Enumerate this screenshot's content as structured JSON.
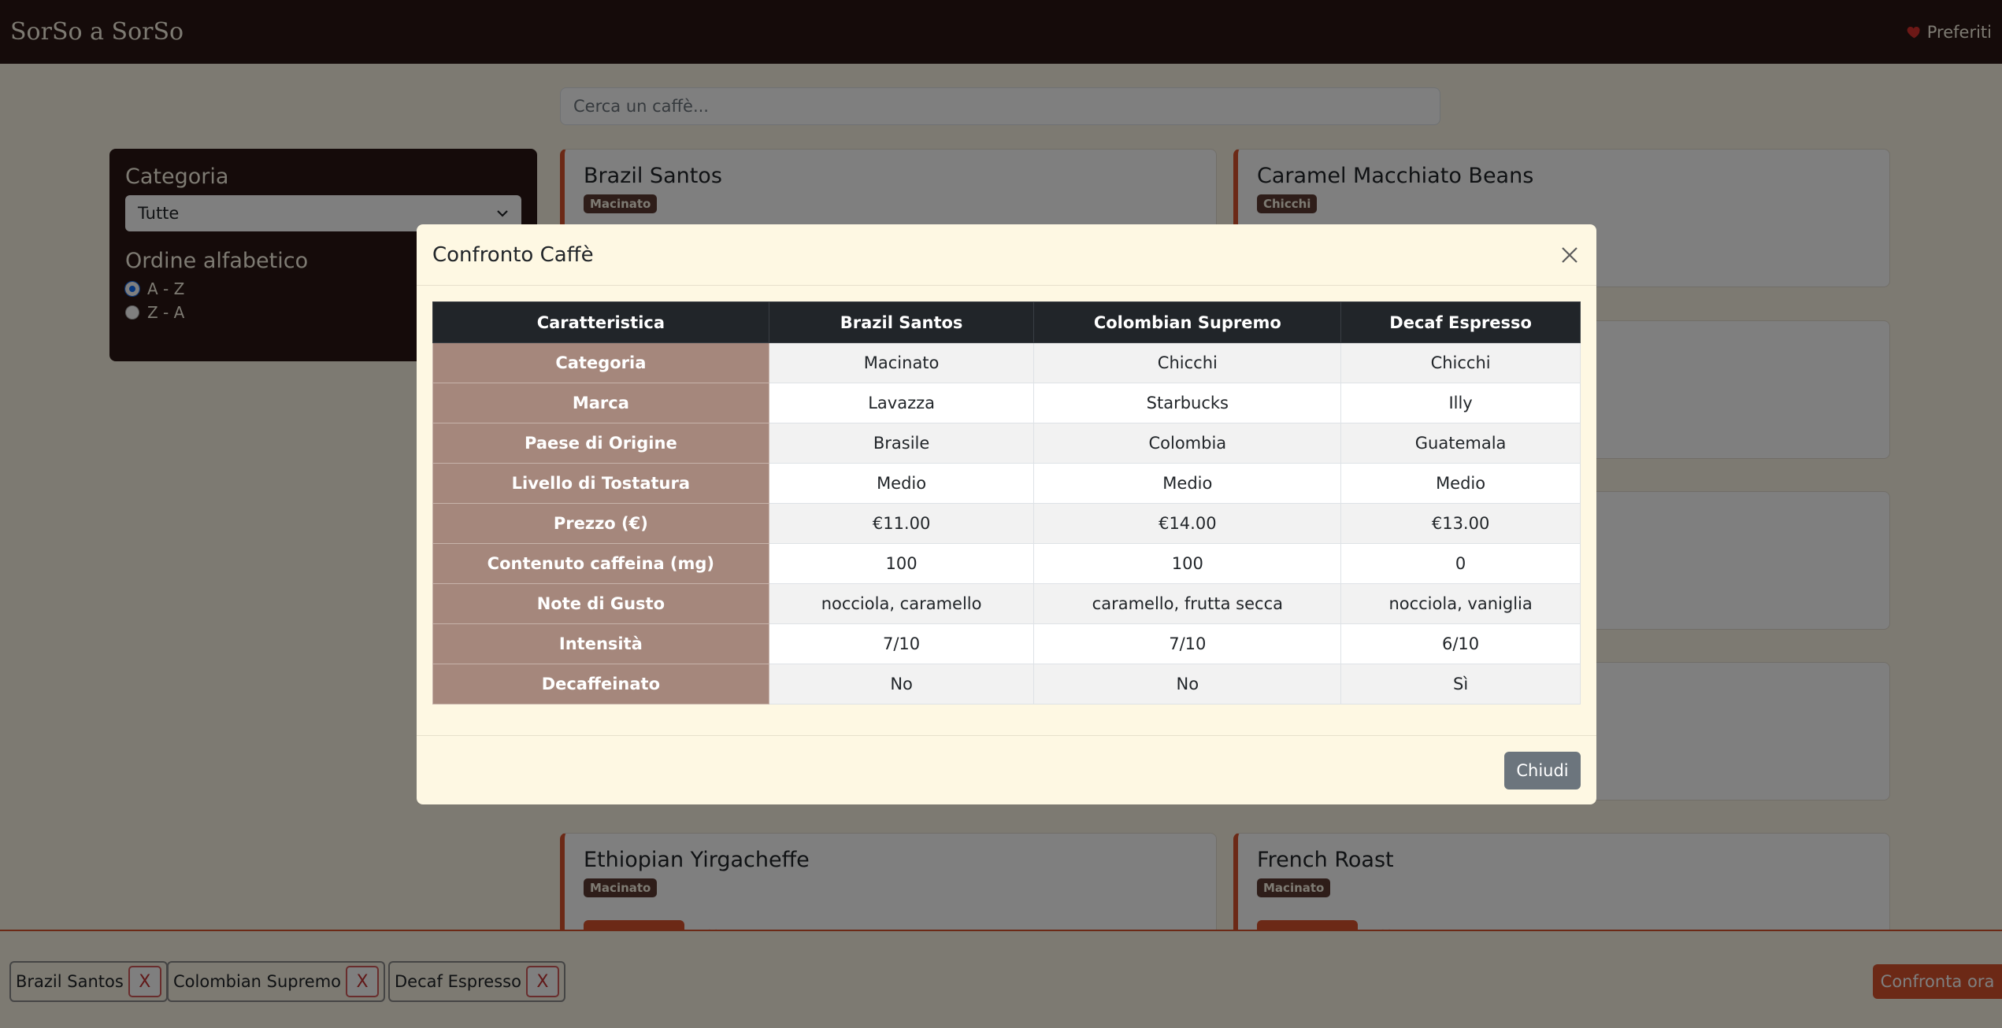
{
  "navbar": {
    "brand": "SorSo a SorSo",
    "favorites_label": "Preferiti"
  },
  "search": {
    "placeholder": "Cerca un caffè..."
  },
  "sidebar": {
    "category_heading": "Categoria",
    "category_selected": "Tutte",
    "order_heading": "Ordine alfabetico",
    "order_options": [
      "A - Z",
      "Z - A"
    ],
    "order_selected": "A - Z"
  },
  "cards": [
    {
      "name": "Brazil Santos",
      "category": "Macinato"
    },
    {
      "name": "Caramel Macchiato Beans",
      "category": "Chicchi"
    },
    {
      "name": "Ethiopian Yirgacheffe",
      "category": "Macinato"
    },
    {
      "name": "French Roast",
      "category": "Macinato"
    }
  ],
  "compare_bar": {
    "chips": [
      "Brazil Santos",
      "Colombian Supremo",
      "Decaf Espresso"
    ],
    "remove_label": "X",
    "compare_now_label": "Confronta ora"
  },
  "modal": {
    "title": "Confronto Caffè",
    "close_label": "Chiudi",
    "headers": [
      "Caratteristica",
      "Brazil Santos",
      "Colombian Supremo",
      "Decaf Espresso"
    ],
    "rows": [
      {
        "label": "Categoria",
        "values": [
          "Macinato",
          "Chicchi",
          "Chicchi"
        ]
      },
      {
        "label": "Marca",
        "values": [
          "Lavazza",
          "Starbucks",
          "Illy"
        ]
      },
      {
        "label": "Paese di Origine",
        "values": [
          "Brasile",
          "Colombia",
          "Guatemala"
        ]
      },
      {
        "label": "Livello di Tostatura",
        "values": [
          "Medio",
          "Medio",
          "Medio"
        ]
      },
      {
        "label": "Prezzo (€)",
        "values": [
          "€11.00",
          "€14.00",
          "€13.00"
        ]
      },
      {
        "label": "Contenuto caffeina (mg)",
        "values": [
          "100",
          "100",
          "0"
        ]
      },
      {
        "label": "Note di Gusto",
        "values": [
          "nocciola, caramello",
          "caramello, frutta secca",
          "nocciola, vaniglia"
        ]
      },
      {
        "label": "Intensità",
        "values": [
          "7/10",
          "7/10",
          "6/10"
        ]
      },
      {
        "label": "Decaffeinato",
        "values": [
          "No",
          "No",
          "Sì"
        ]
      }
    ]
  },
  "colors": {
    "navbar": "#2b1714",
    "accent": "#d9532c",
    "page_bg": "#fbf4e4",
    "modal_bg": "#fef8e3",
    "label_cell": "#a5877c"
  },
  "icons": {
    "favorites": "heart-icon",
    "select": "chevron-down-icon",
    "modal_close": "close-icon"
  }
}
